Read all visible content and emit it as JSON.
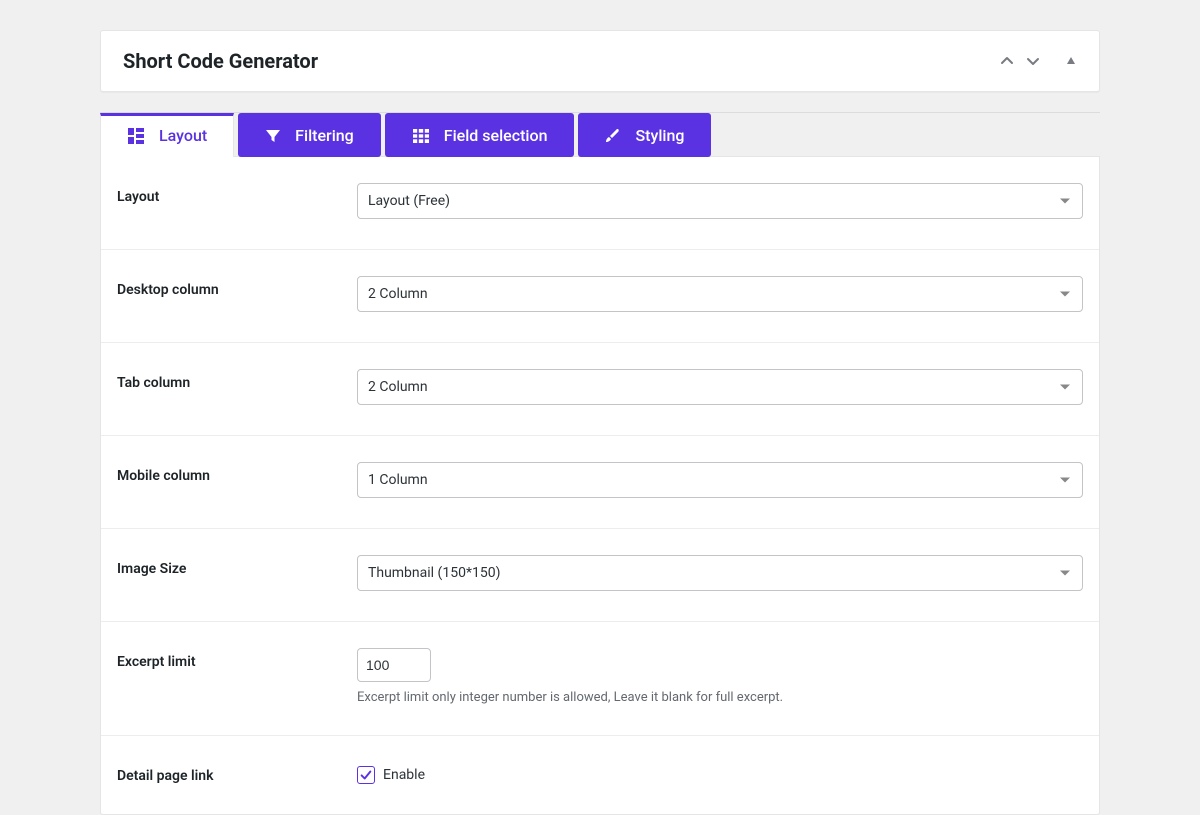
{
  "header": {
    "title": "Short Code Generator"
  },
  "tabs": [
    {
      "label": "Layout"
    },
    {
      "label": "Filtering"
    },
    {
      "label": "Field selection"
    },
    {
      "label": "Styling"
    }
  ],
  "fields": {
    "layout": {
      "label": "Layout",
      "value": "Layout (Free)"
    },
    "desktop_column": {
      "label": "Desktop column",
      "value": "2 Column"
    },
    "tab_column": {
      "label": "Tab column",
      "value": "2 Column"
    },
    "mobile_column": {
      "label": "Mobile column",
      "value": "1 Column"
    },
    "image_size": {
      "label": "Image Size",
      "value": "Thumbnail (150*150)"
    },
    "excerpt_limit": {
      "label": "Excerpt limit",
      "value": "100",
      "help": "Excerpt limit only integer number is allowed, Leave it blank for full excerpt."
    },
    "detail_page_link": {
      "label": "Detail page link",
      "checkbox_label": "Enable",
      "checked": true
    }
  }
}
